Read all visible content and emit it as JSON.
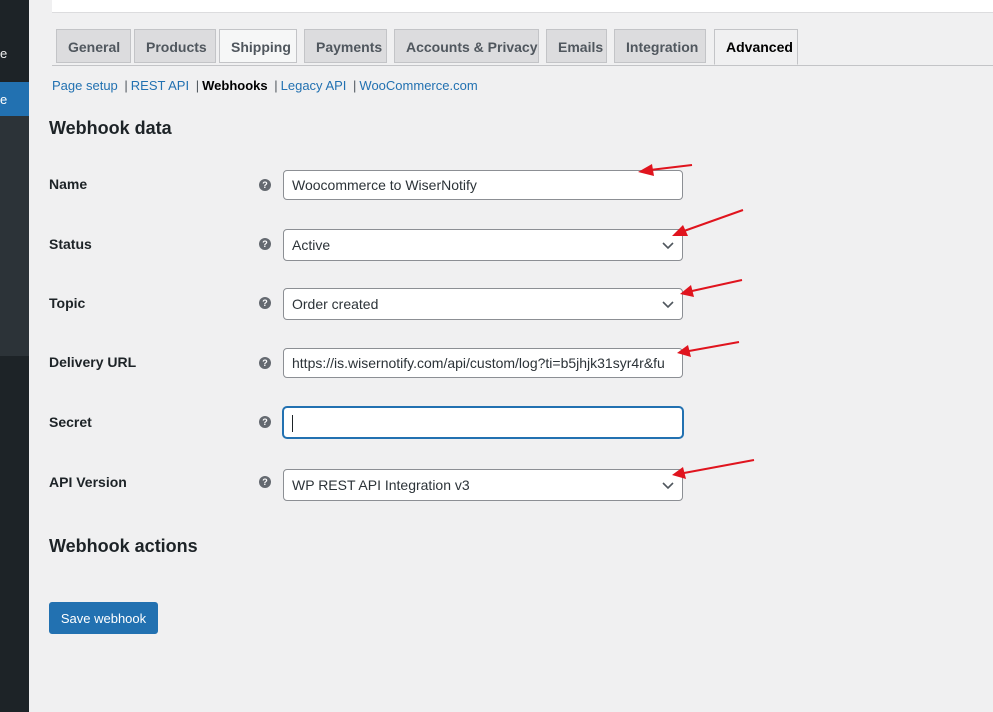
{
  "sidebar": {
    "fragment_1": "e",
    "fragment_2": "e"
  },
  "tabs": [
    {
      "label": "General"
    },
    {
      "label": "Products"
    },
    {
      "label": "Shipping"
    },
    {
      "label": "Payments"
    },
    {
      "label": "Accounts & Privacy"
    },
    {
      "label": "Emails"
    },
    {
      "label": "Integration"
    },
    {
      "label": "Advanced"
    }
  ],
  "subnav": {
    "items": [
      "Page setup",
      "REST API",
      "Webhooks",
      "Legacy API",
      "WooCommerce.com"
    ],
    "separator": "|",
    "current": "Webhooks"
  },
  "webhook_data": {
    "heading": "Webhook data",
    "name": {
      "label": "Name",
      "value": "Woocommerce to WiserNotify"
    },
    "status": {
      "label": "Status",
      "value": "Active"
    },
    "topic": {
      "label": "Topic",
      "value": "Order created"
    },
    "delivery_url": {
      "label": "Delivery URL",
      "value": "https://is.wisernotify.com/api/custom/log?ti=b5jhjk31syr4r&fu"
    },
    "secret": {
      "label": "Secret",
      "value": ""
    },
    "api_version": {
      "label": "API Version",
      "value": "WP REST API Integration v3"
    },
    "help_glyph": "?"
  },
  "webhook_actions": {
    "heading": "Webhook actions"
  },
  "save_button": "Save webhook",
  "colors": {
    "accent": "#2271b1",
    "annotation_arrow": "#e0141e",
    "sidebar": "#1d2327"
  }
}
